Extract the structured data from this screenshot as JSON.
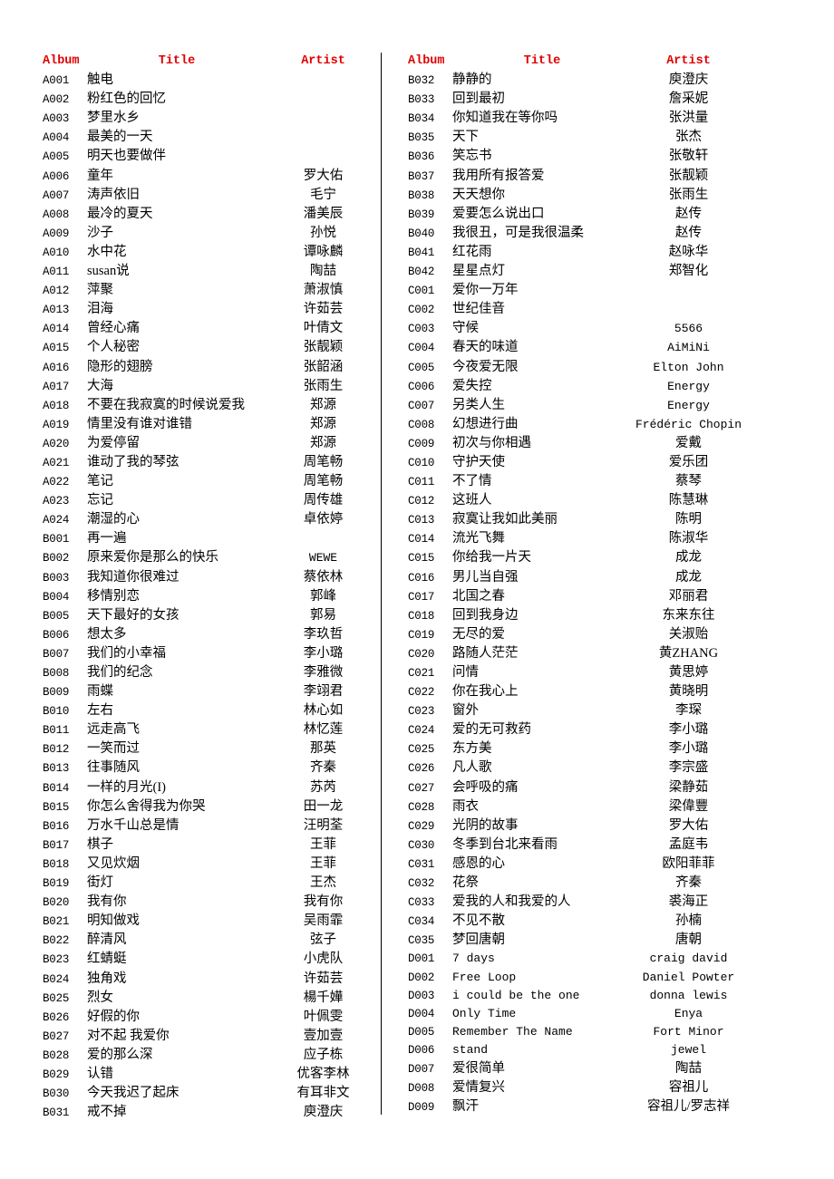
{
  "document": {
    "title": "Song Album Listing",
    "accent_color": "#e00000",
    "text_color": "#000000",
    "background_color": "#ffffff"
  },
  "headers": {
    "album": "Album",
    "title": "Title",
    "artist": "Artist"
  },
  "left_column": [
    {
      "album": "A001",
      "title": "触电",
      "artist": ""
    },
    {
      "album": "A002",
      "title": "粉红色的回忆",
      "artist": ""
    },
    {
      "album": "A003",
      "title": "梦里水乡",
      "artist": ""
    },
    {
      "album": "A004",
      "title": "最美的一天",
      "artist": ""
    },
    {
      "album": "A005",
      "title": "明天也要做伴",
      "artist": ""
    },
    {
      "album": "A006",
      "title": "童年",
      "artist": "罗大佑"
    },
    {
      "album": "A007",
      "title": "涛声依旧",
      "artist": "毛宁"
    },
    {
      "album": "A008",
      "title": "最冷的夏天",
      "artist": "潘美辰"
    },
    {
      "album": "A009",
      "title": "沙子",
      "artist": "孙悦"
    },
    {
      "album": "A010",
      "title": "水中花",
      "artist": "谭咏麟"
    },
    {
      "album": "A011",
      "title": "susan说",
      "artist": "陶喆"
    },
    {
      "album": "A012",
      "title": "萍聚",
      "artist": "萧淑慎"
    },
    {
      "album": "A013",
      "title": "泪海",
      "artist": "许茹芸"
    },
    {
      "album": "A014",
      "title": "曾经心痛",
      "artist": "叶倩文"
    },
    {
      "album": "A015",
      "title": "个人秘密",
      "artist": "张靓颖"
    },
    {
      "album": "A016",
      "title": "隐形的翅膀",
      "artist": "张韶涵"
    },
    {
      "album": "A017",
      "title": "大海",
      "artist": "张雨生"
    },
    {
      "album": "A018",
      "title": "不要在我寂寞的时候说爱我",
      "artist": "郑源"
    },
    {
      "album": "A019",
      "title": "情里没有谁对谁错",
      "artist": "郑源"
    },
    {
      "album": "A020",
      "title": "为爱停留",
      "artist": "郑源"
    },
    {
      "album": "A021",
      "title": "谁动了我的琴弦",
      "artist": "周笔畅"
    },
    {
      "album": "A022",
      "title": "笔记",
      "artist": "周笔畅"
    },
    {
      "album": "A023",
      "title": "忘记",
      "artist": "周传雄"
    },
    {
      "album": "A024",
      "title": "潮湿的心",
      "artist": "卓依婷"
    },
    {
      "album": "B001",
      "title": "再一遍",
      "artist": ""
    },
    {
      "album": "B002",
      "title": "原来爱你是那么的快乐",
      "artist": "WEWE",
      "artist_latin": true
    },
    {
      "album": "B003",
      "title": "我知道你很难过",
      "artist": "蔡依林"
    },
    {
      "album": "B004",
      "title": "移情别恋",
      "artist": "郭峰"
    },
    {
      "album": "B005",
      "title": "天下最好的女孩",
      "artist": "郭易"
    },
    {
      "album": "B006",
      "title": "想太多",
      "artist": "李玖哲"
    },
    {
      "album": "B007",
      "title": "我们的小幸福",
      "artist": "李小璐"
    },
    {
      "album": "B008",
      "title": "我们的纪念",
      "artist": "李雅微"
    },
    {
      "album": "B009",
      "title": "雨蝶",
      "artist": "李翊君"
    },
    {
      "album": "B010",
      "title": "左右",
      "artist": "林心如"
    },
    {
      "album": "B011",
      "title": "远走高飞",
      "artist": "林忆莲"
    },
    {
      "album": "B012",
      "title": "一笑而过",
      "artist": "那英"
    },
    {
      "album": "B013",
      "title": "往事随风",
      "artist": "齐秦"
    },
    {
      "album": "B014",
      "title": "一样的月光(I)",
      "artist": "苏芮"
    },
    {
      "album": "B015",
      "title": "你怎么舍得我为你哭",
      "artist": "田一龙"
    },
    {
      "album": "B016",
      "title": "万水千山总是情",
      "artist": "汪明荃"
    },
    {
      "album": "B017",
      "title": "棋子",
      "artist": "王菲"
    },
    {
      "album": "B018",
      "title": "又见炊烟",
      "artist": "王菲"
    },
    {
      "album": "B019",
      "title": "街灯",
      "artist": "王杰"
    },
    {
      "album": "B020",
      "title": "我有你",
      "artist": "我有你"
    },
    {
      "album": "B021",
      "title": "明知做戏",
      "artist": "吴雨霏"
    },
    {
      "album": "B022",
      "title": "醉清风",
      "artist": "弦子"
    },
    {
      "album": "B023",
      "title": "红蜻蜓",
      "artist": "小虎队"
    },
    {
      "album": "B024",
      "title": "独角戏",
      "artist": "许茹芸"
    },
    {
      "album": "B025",
      "title": "烈女",
      "artist": "楊千嬅"
    },
    {
      "album": "B026",
      "title": "好假的你",
      "artist": "叶佩雯"
    },
    {
      "album": "B027",
      "title": "对不起 我爱你",
      "artist": "壹加壹"
    },
    {
      "album": "B028",
      "title": "爱的那么深",
      "artist": "应子栋"
    },
    {
      "album": "B029",
      "title": "认错",
      "artist": "优客李林"
    },
    {
      "album": "B030",
      "title": "今天我迟了起床",
      "artist": "有耳非文"
    },
    {
      "album": "B031",
      "title": "戒不掉",
      "artist": "庾澄庆"
    }
  ],
  "right_column": [
    {
      "album": "B032",
      "title": "静静的",
      "artist": "庾澄庆"
    },
    {
      "album": "B033",
      "title": "回到最初",
      "artist": "詹采妮"
    },
    {
      "album": "B034",
      "title": "你知道我在等你吗",
      "artist": "张洪量"
    },
    {
      "album": "B035",
      "title": "天下",
      "artist": "张杰"
    },
    {
      "album": "B036",
      "title": "笑忘书",
      "artist": "张敬轩"
    },
    {
      "album": "B037",
      "title": "我用所有报答爱",
      "artist": "张靓颖"
    },
    {
      "album": "B038",
      "title": "天天想你",
      "artist": "张雨生"
    },
    {
      "album": "B039",
      "title": "爱要怎么说出口",
      "artist": "赵传"
    },
    {
      "album": "B040",
      "title": "我很丑，可是我很温柔",
      "artist": "赵传"
    },
    {
      "album": "B041",
      "title": "红花雨",
      "artist": "赵咏华"
    },
    {
      "album": "B042",
      "title": "星星点灯",
      "artist": "郑智化"
    },
    {
      "album": "C001",
      "title": "爱你一万年",
      "artist": ""
    },
    {
      "album": "C002",
      "title": "世纪佳音",
      "artist": ""
    },
    {
      "album": "C003",
      "title": "守候",
      "artist": "5566",
      "artist_latin": true
    },
    {
      "album": "C004",
      "title": "春天的味道",
      "artist": "AiMiNi",
      "artist_latin": true
    },
    {
      "album": "C005",
      "title": "今夜爱无限",
      "artist": "Elton John",
      "artist_latin": true
    },
    {
      "album": "C006",
      "title": "爱失控",
      "artist": "Energy",
      "artist_latin": true
    },
    {
      "album": "C007",
      "title": "另类人生",
      "artist": "Energy",
      "artist_latin": true
    },
    {
      "album": "C008",
      "title": "幻想进行曲",
      "artist": "Frédéric Chopin",
      "artist_latin": true,
      "artist_wide": true
    },
    {
      "album": "C009",
      "title": "初次与你相遇",
      "artist": "爱戴"
    },
    {
      "album": "C010",
      "title": "守护天使",
      "artist": "爱乐团"
    },
    {
      "album": "C011",
      "title": "不了情",
      "artist": "蔡琴"
    },
    {
      "album": "C012",
      "title": "这班人",
      "artist": "陈慧琳"
    },
    {
      "album": "C013",
      "title": "寂寞让我如此美丽",
      "artist": "陈明"
    },
    {
      "album": "C014",
      "title": "流光飞舞",
      "artist": "陈淑华"
    },
    {
      "album": "C015",
      "title": "你给我一片天",
      "artist": "成龙"
    },
    {
      "album": "C016",
      "title": "男儿当自强",
      "artist": "成龙"
    },
    {
      "album": "C017",
      "title": "北国之春",
      "artist": "邓丽君"
    },
    {
      "album": "C018",
      "title": "回到我身边",
      "artist": "东来东往"
    },
    {
      "album": "C019",
      "title": "无尽的爱",
      "artist": "关淑贻"
    },
    {
      "album": "C020",
      "title": "路随人茫茫",
      "artist": "黄ZHANG"
    },
    {
      "album": "C021",
      "title": "问情",
      "artist": "黄思婷"
    },
    {
      "album": "C022",
      "title": "你在我心上",
      "artist": "黄晓明"
    },
    {
      "album": "C023",
      "title": "窗外",
      "artist": "李琛"
    },
    {
      "album": "C024",
      "title": "爱的无可救药",
      "artist": "李小璐"
    },
    {
      "album": "C025",
      "title": "东方美",
      "artist": "李小璐"
    },
    {
      "album": "C026",
      "title": "凡人歌",
      "artist": "李宗盛"
    },
    {
      "album": "C027",
      "title": "会呼吸的痛",
      "artist": "梁静茹"
    },
    {
      "album": "C028",
      "title": "雨衣",
      "artist": "梁偉豐"
    },
    {
      "album": "C029",
      "title": "光阴的故事",
      "artist": "罗大佑"
    },
    {
      "album": "C030",
      "title": "冬季到台北来看雨",
      "artist": "孟庭韦"
    },
    {
      "album": "C031",
      "title": "感恩的心",
      "artist": "欧阳菲菲"
    },
    {
      "album": "C032",
      "title": "花祭",
      "artist": "齐秦"
    },
    {
      "album": "C033",
      "title": "爱我的人和我爱的人",
      "artist": "裘海正"
    },
    {
      "album": "C034",
      "title": "不见不散",
      "artist": "孙楠"
    },
    {
      "album": "C035",
      "title": "梦回唐朝",
      "artist": "唐朝"
    },
    {
      "album": "D001",
      "title": "7 days",
      "title_latin": true,
      "artist": "craig david",
      "artist_latin": true
    },
    {
      "album": "D002",
      "title": "Free Loop",
      "title_latin": true,
      "artist": "Daniel Powter",
      "artist_latin": true,
      "artist_wide": true
    },
    {
      "album": "D003",
      "title": "i could be the one",
      "title_latin": true,
      "artist": "donna lewis",
      "artist_latin": true
    },
    {
      "album": "D004",
      "title": "Only Time",
      "title_latin": true,
      "artist": "Enya",
      "artist_latin": true
    },
    {
      "album": "D005",
      "title": "Remember The Name",
      "title_latin": true,
      "artist": "Fort Minor",
      "artist_latin": true
    },
    {
      "album": "D006",
      "title": "stand",
      "title_latin": true,
      "artist": "jewel",
      "artist_latin": true
    },
    {
      "album": "D007",
      "title": "爱很简单",
      "artist": "陶喆"
    },
    {
      "album": "D008",
      "title": "爱情复兴",
      "artist": "容祖儿"
    },
    {
      "album": "D009",
      "title": "飘汗",
      "artist": "容祖儿/罗志祥"
    }
  ]
}
